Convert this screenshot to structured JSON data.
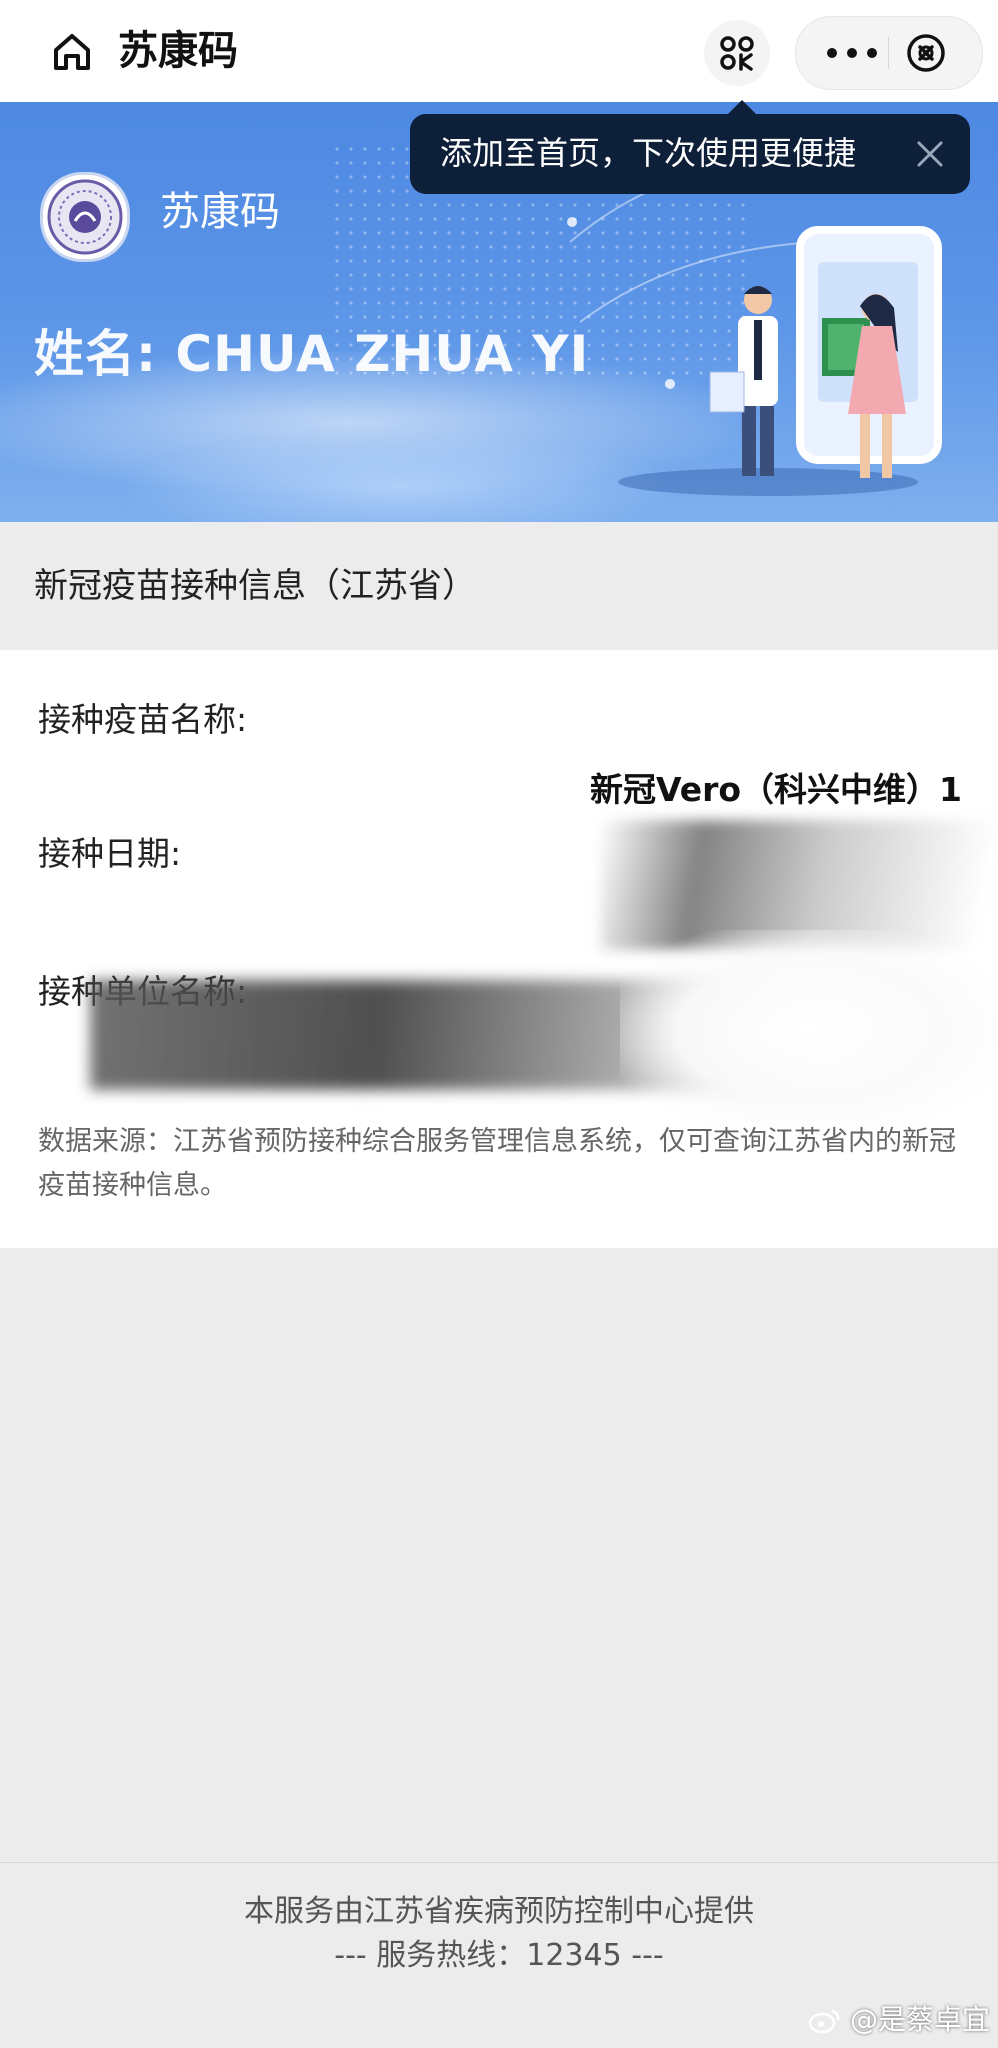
{
  "nav": {
    "title": "苏康码"
  },
  "tooltip": {
    "text": "添加至首页，下次使用更便捷"
  },
  "banner": {
    "title": "苏康码",
    "name_row": "姓名: CHUA ZHUA YI"
  },
  "section": {
    "title": "新冠疫苗接种信息（江苏省）"
  },
  "card": {
    "vaccine_name_label": "接种疫苗名称:",
    "vaccine_name_value": "新冠Vero（科兴中维）1",
    "date_label": "接种日期:",
    "unit_label": "接种单位名称:",
    "footnote": "数据来源：江苏省预防接种综合服务管理信息系统，仅可查询江苏省内的新冠疫苗接种信息。"
  },
  "footer": {
    "line1": "本服务由江苏省疾病预防控制中心提供",
    "line2": "--- 服务热线：12345 ---"
  },
  "watermark": {
    "text": "@是蔡卓宜"
  },
  "colors": {
    "banner_blue": "#4d88e2",
    "tooltip_bg": "#0e1f39",
    "page_bg": "#ececec"
  }
}
